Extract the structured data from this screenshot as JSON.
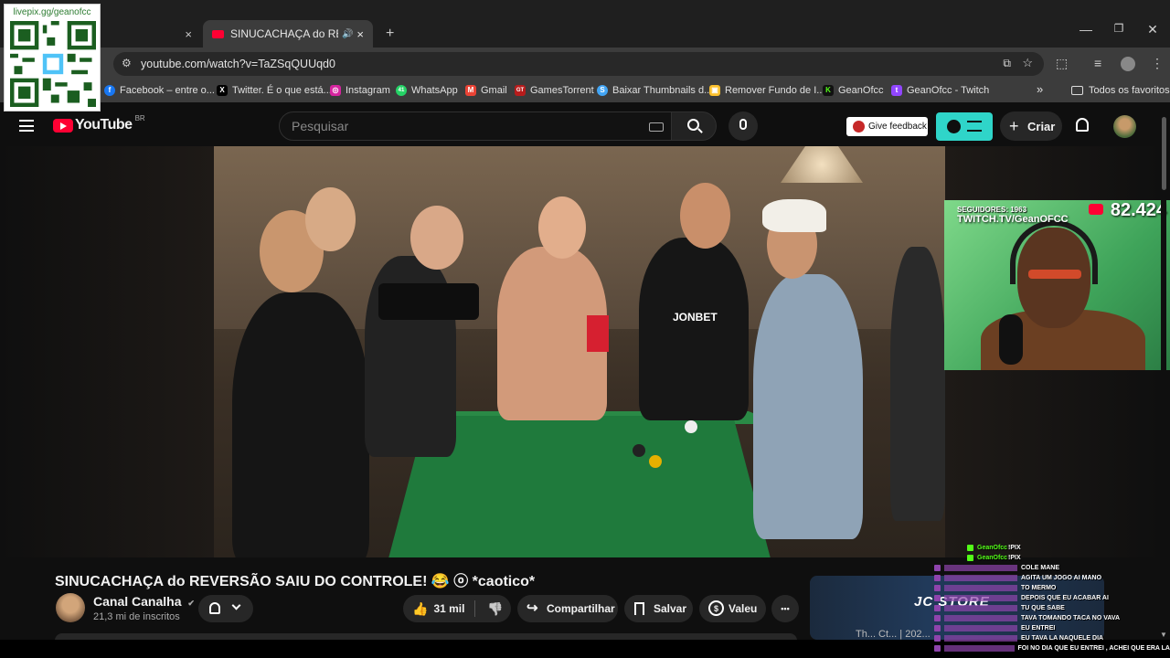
{
  "qr": {
    "label": "livepix.gg/geanofcc"
  },
  "tabs": [
    {
      "label": "",
      "close": "×"
    },
    {
      "label": "SINUCACHAÇA do REVERSÃ",
      "close": "×",
      "sound": "🔊"
    }
  ],
  "new_tab": "+",
  "window_controls": {
    "minimize": "—",
    "restore": "❐",
    "close": "✕"
  },
  "url": "youtube.com/watch?v=TaZSqQUUqd0",
  "bookmarks": [
    {
      "label": "Facebook – entre o...",
      "color": "#1877f2",
      "glyph": "f"
    },
    {
      "label": "Twitter. É o que está...",
      "color": "#000000",
      "glyph": "X"
    },
    {
      "label": "Instagram",
      "color": "#d6249f",
      "glyph": "◎"
    },
    {
      "label": "WhatsApp",
      "color": "#25d366",
      "glyph": "41"
    },
    {
      "label": "Gmail",
      "color": "#ea4335",
      "glyph": "M"
    },
    {
      "label": "GamesTorrent",
      "color": "#b71c1c",
      "glyph": "GT"
    },
    {
      "label": "Baixar Thumbnails d...",
      "color": "#42a5f5",
      "glyph": "S"
    },
    {
      "label": "Remover Fundo de I...",
      "color": "#fbc02d",
      "glyph": "▣"
    },
    {
      "label": "GeanOfcc",
      "color": "#53fc18",
      "glyph": "K"
    },
    {
      "label": "GeanOfcc - Twitch",
      "color": "#9146ff",
      "glyph": "t"
    }
  ],
  "bookmarks_more": "»",
  "all_bookmarks": "Todos os favoritos",
  "youtube": {
    "logo_text": "YouTube",
    "region": "BR",
    "search_placeholder": "Pesquisar",
    "feedback_label": "Give feedback",
    "create_label": "Criar"
  },
  "video": {
    "title": "SINUCACHAÇA do REVERSÃO SAIU DO CONTROLE! 😂 ⓞ *caotico*",
    "channel_name": "Canal Canalha",
    "verified": "✔",
    "subscribers": "21,3 mi de inscritos",
    "likes": "31 mil",
    "share_label": "Compartilhar",
    "save_label": "Salvar",
    "thanks_label": "Valeu",
    "more": "•••"
  },
  "webcam": {
    "followers": "SEGUIDORES: 1963",
    "twitch": "TWITCH.TV/GeanOFCC",
    "count": "82.424"
  },
  "recommendation": {
    "brand": "JC STORE",
    "partial_title": "Th... Ct... | 202..."
  },
  "chat": [
    {
      "user": "GeanOfcc",
      "msg": "!PIX",
      "color": "#53fc18"
    },
    {
      "user": "GeanOfcc",
      "msg": "!PIX",
      "color": "#53fc18"
    },
    {
      "user": "",
      "msg": "COLE MANE",
      "color": "#8e44ad"
    },
    {
      "user": "",
      "msg": "AGITA UM JOGO AI MANO",
      "color": "#8e44ad"
    },
    {
      "user": "",
      "msg": "TO MERMO",
      "color": "#8e44ad"
    },
    {
      "user": "",
      "msg": "DEPOIS QUE EU ACABAR AI",
      "color": "#8e44ad"
    },
    {
      "user": "",
      "msg": "TU QUE SABE",
      "color": "#8e44ad"
    },
    {
      "user": "",
      "msg": "TAVA TOMANDO TACA NO VAVA",
      "color": "#8e44ad"
    },
    {
      "user": "",
      "msg": "EU ENTREI",
      "color": "#8e44ad"
    },
    {
      "user": "",
      "msg": "EU TAVA LA NAQUELE DIA",
      "color": "#8e44ad"
    },
    {
      "user": "",
      "msg": "FOI NO DIA QUE EU ENTREI , ACHEI QUE ERA LA",
      "color": "#8e44ad"
    }
  ]
}
